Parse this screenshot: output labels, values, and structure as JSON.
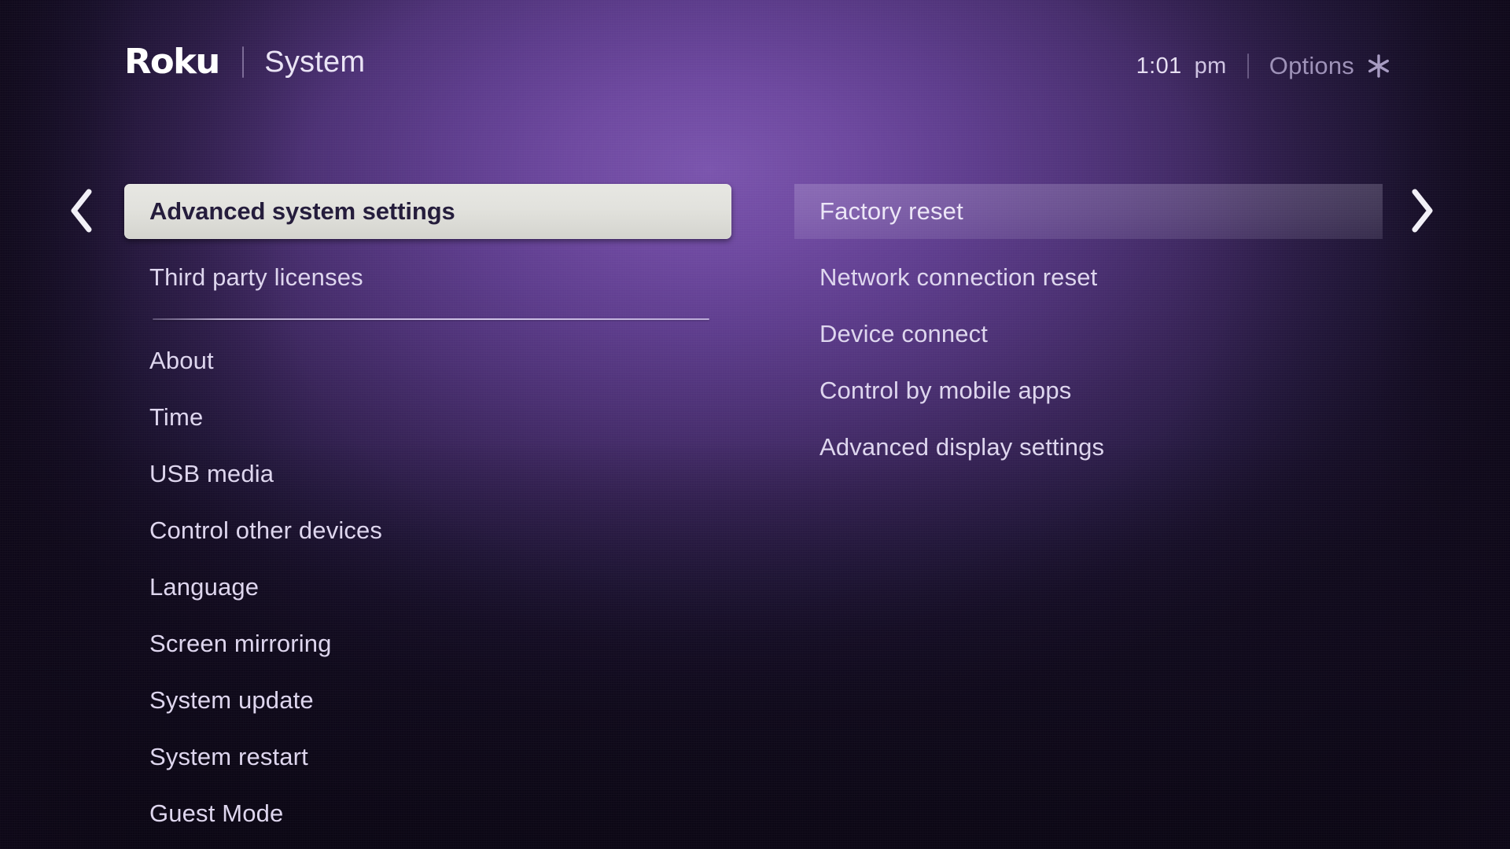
{
  "header": {
    "brand": "Roku",
    "divider": "|",
    "title": "System",
    "time": "1:01",
    "ampm": "pm",
    "divider2": "|",
    "options_label": "Options",
    "options_icon": "asterisk-icon"
  },
  "nav": {
    "left_arrow_icon": "chevron-left-icon",
    "right_arrow_icon": "chevron-right-icon"
  },
  "left_column": {
    "selected_index": 0,
    "items": [
      {
        "label": "Advanced system settings",
        "state": "selected"
      },
      {
        "label": "Third party licenses",
        "state": "normal"
      }
    ],
    "items_after_separator": [
      {
        "label": "About",
        "state": "normal"
      },
      {
        "label": "Time",
        "state": "normal"
      },
      {
        "label": "USB media",
        "state": "normal"
      },
      {
        "label": "Control other devices",
        "state": "normal"
      },
      {
        "label": "Language",
        "state": "normal"
      },
      {
        "label": "Screen mirroring",
        "state": "normal"
      },
      {
        "label": "System update",
        "state": "normal"
      },
      {
        "label": "System restart",
        "state": "normal"
      },
      {
        "label": "Guest Mode",
        "state": "normal"
      }
    ]
  },
  "right_column": {
    "active_index": 0,
    "items": [
      {
        "label": "Factory reset",
        "state": "active"
      },
      {
        "label": "Network connection reset",
        "state": "normal"
      },
      {
        "label": "Device connect",
        "state": "normal"
      },
      {
        "label": "Control by mobile apps",
        "state": "normal"
      },
      {
        "label": "Advanced display settings",
        "state": "normal"
      }
    ]
  },
  "colors": {
    "background_center": "#6d489f",
    "background_edge": "#150e24",
    "selected_pill": "#e2e2dd",
    "selected_text": "#251d3c",
    "item_text": "#ded6ee",
    "options_text": "#9e92b8",
    "accent_white": "#ffffff"
  }
}
